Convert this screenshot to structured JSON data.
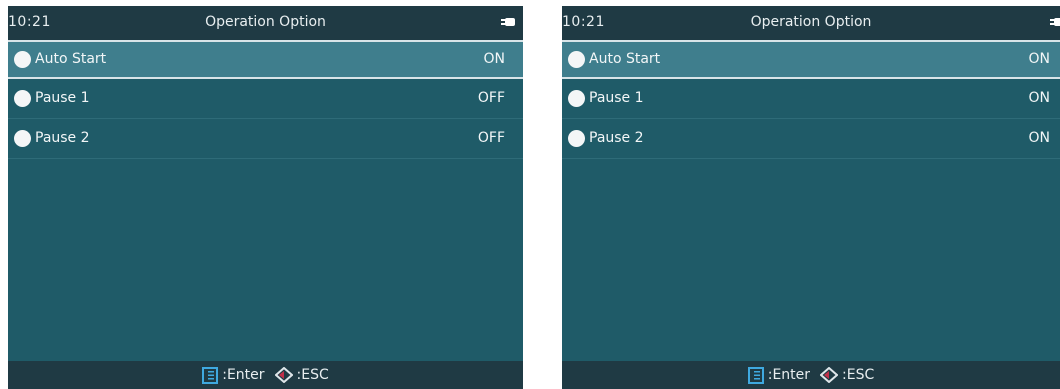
{
  "screens": [
    {
      "clock": "10:21",
      "title": "Operation Option",
      "status_icon": "plug-icon",
      "items": [
        {
          "label": "Auto Start",
          "value": "ON",
          "selected": true
        },
        {
          "label": "Pause 1",
          "value": "OFF",
          "selected": false
        },
        {
          "label": "Pause 2",
          "value": "OFF",
          "selected": false
        }
      ],
      "footer": {
        "enter_label": ":Enter",
        "esc_label": ":ESC"
      }
    },
    {
      "clock": "10:21",
      "title": "Operation Option",
      "status_icon": "plug-icon",
      "items": [
        {
          "label": "Auto Start",
          "value": "ON",
          "selected": true
        },
        {
          "label": "Pause 1",
          "value": "ON",
          "selected": false
        },
        {
          "label": "Pause 2",
          "value": "ON",
          "selected": false
        }
      ],
      "footer": {
        "enter_label": ":Enter",
        "esc_label": ":ESC"
      }
    }
  ],
  "colors": {
    "background": "#1f5b68",
    "bars": "#1f3a44",
    "selected_row": "#3f7e8d",
    "enter_icon": "#3fa9e0",
    "esc_icon_accent": "#c0304a"
  }
}
